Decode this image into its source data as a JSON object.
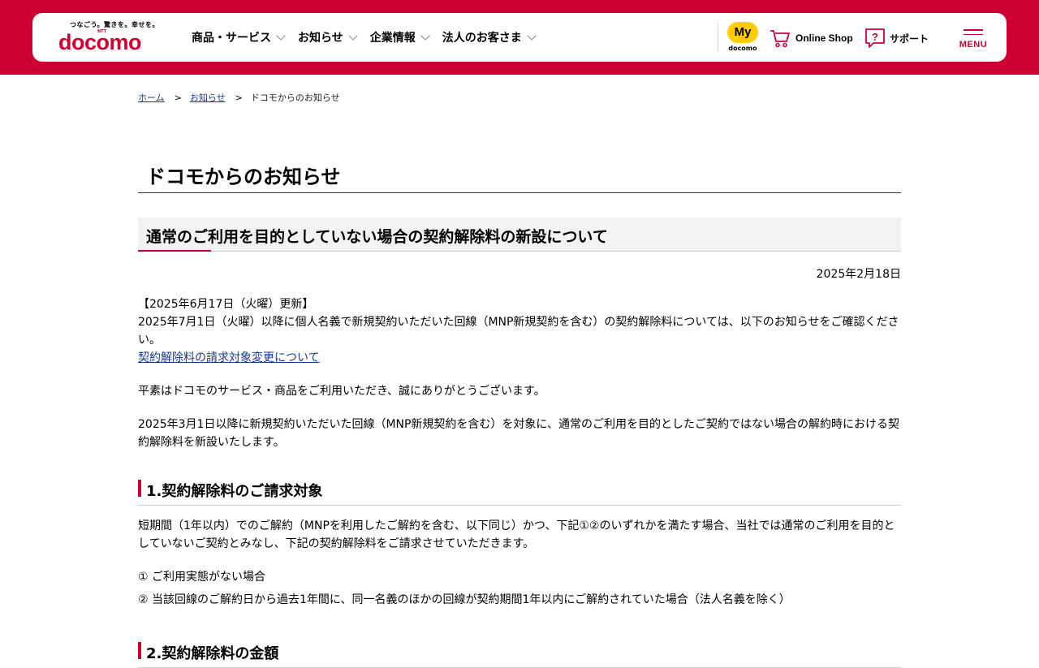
{
  "header": {
    "tagline": "つなごう。驚きを。幸せを。",
    "logo_text": "docomo",
    "logo_sub": "NTT",
    "nav": [
      {
        "label": "商品・サービス"
      },
      {
        "label": "お知らせ"
      },
      {
        "label": "企業情報"
      },
      {
        "label": "法人のお客さま"
      }
    ],
    "mydocomo": {
      "main": "My",
      "sub": "docomo"
    },
    "online_shop": "Online Shop",
    "support": "サポート",
    "menu": "MENU",
    "colors": {
      "brand": "#cc0033",
      "my_yellow": "#ffcc00"
    }
  },
  "breadcrumb": {
    "home": "ホーム",
    "sep": ">",
    "notices": "お知らせ",
    "current": "ドコモからのお知らせ"
  },
  "page_title": "ドコモからのお知らせ",
  "notice": {
    "title": "通常のご利用を目的としていない場合の契約解除料の新設について",
    "date": "2025年2月18日",
    "update_head": "【2025年6月17日（火曜）更新】",
    "update_body": "2025年7月1日（火曜）以降に個人名義で新規契約いただいた回線（MNP新規契約を含む）の契約解除料については、以下のお知らせをご確認ください。",
    "update_link": "契約解除料の請求対象変更について",
    "greeting": "平素はドコモのサービス・商品をご利用いただき、誠にありがとうございます。",
    "intro": "2025年3月1日以降に新規契約いただいた回線（MNP新規契約を含む）を対象に、通常のご利用を目的としたご契約ではない場合の解約時における契約解除料を新設いたします。"
  },
  "section1": {
    "heading": "1.契約解除料のご請求対象",
    "body": "短期間（1年以内）でのご解約（MNPを利用したご解約を含む、以下同じ）かつ、下記①②のいずれかを満たす場合、当社では通常のご利用を目的としていないご契約とみなし、下記の契約解除料をご請求させていただきます。",
    "item1": "① ご利用実態がない場合",
    "item2": "② 当該回線のご解約日から過去1年間に、同一名義のほかの回線が契約期間1年以内にご解約されていた場合（法人名義を除く）"
  },
  "section2": {
    "heading": "2.契約解除料の金額"
  }
}
